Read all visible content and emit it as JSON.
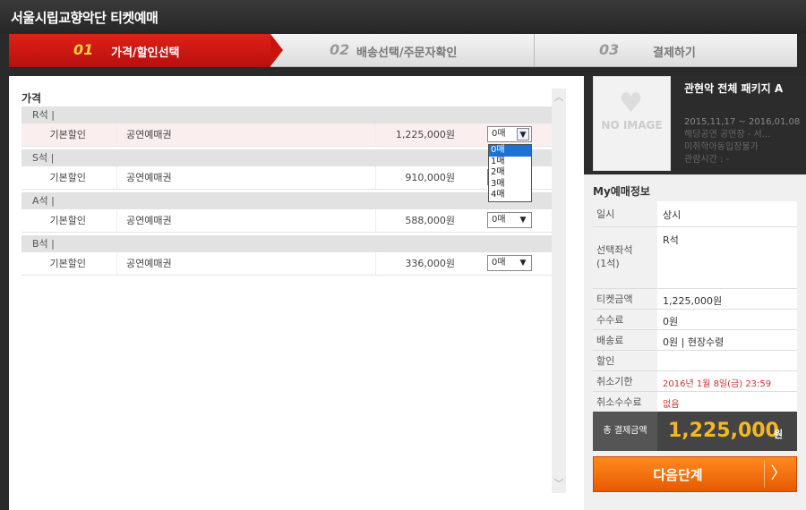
{
  "app": {
    "title": "서울시립교향악단 티켓예매"
  },
  "steps": [
    {
      "num": "01",
      "label": "가격/할인선택",
      "active": true
    },
    {
      "num": "02",
      "label": "배송선택/주문자확인",
      "active": false
    },
    {
      "num": "03",
      "label": "결제하기",
      "active": false
    }
  ],
  "price_section": {
    "title": "가격",
    "grades": [
      {
        "name": "R석  |",
        "discount": "기본할인",
        "ticket": "공연예매권",
        "price": "1,225,000원",
        "selected": "0매"
      },
      {
        "name": "S석  |",
        "discount": "기본할인",
        "ticket": "공연예매권",
        "price": "910,000원",
        "selected": "0매"
      },
      {
        "name": "A석  |",
        "discount": "기본할인",
        "ticket": "공연예매권",
        "price": "588,000원",
        "selected": "0매"
      },
      {
        "name": "B석  |",
        "discount": "기본할인",
        "ticket": "공연예매권",
        "price": "336,000원",
        "selected": "0매"
      }
    ],
    "dropdown_options": [
      "0매",
      "1매",
      "2매",
      "3매",
      "4매"
    ]
  },
  "show": {
    "no_image": "NO IMAGE",
    "title": "관현악 전체 패키지 A",
    "dates": "2015,11,17 ~ 2016,01,08",
    "venue": "해당공연 공연장 - 서...",
    "age": "미취학아동입장불가",
    "duration": "관람시간 : -"
  },
  "my_info": {
    "title": "My예매정보",
    "rows": [
      {
        "key": "일시",
        "value": "상시"
      },
      {
        "key": "선택좌석\n(1석)",
        "value": "R석"
      },
      {
        "key": "티켓금액",
        "value": "1,225,000원"
      },
      {
        "key": "수수료",
        "value": "0원"
      },
      {
        "key": "배송료",
        "value": "0원 | 현장수령"
      },
      {
        "key": "할인",
        "value": ""
      },
      {
        "key": "취소기한",
        "value": "2016년 1월 8일(금) 23:59"
      },
      {
        "key": "취소수수료",
        "value": "없음"
      }
    ],
    "total_label": "총 결제금액",
    "total_value": "1,225,000",
    "total_unit": "원"
  },
  "next_button": {
    "label": "다음단계"
  },
  "colors": {
    "accent_red": "#c8140f",
    "accent_orange": "#f07010",
    "total_gold": "#f5b820"
  }
}
